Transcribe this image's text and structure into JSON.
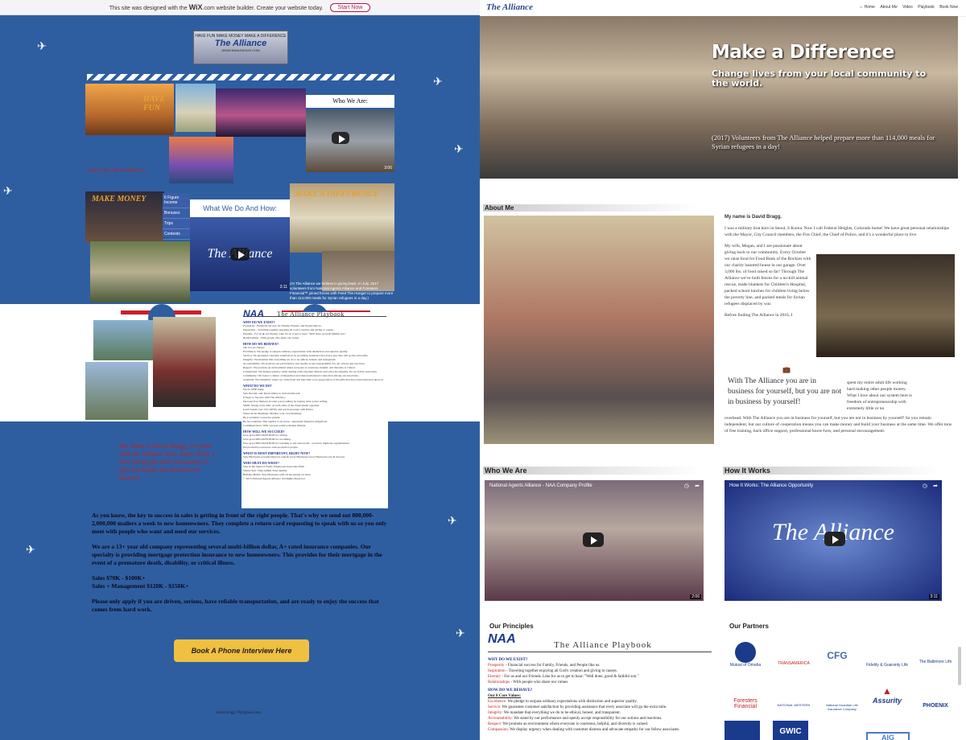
{
  "wix_banner": {
    "text": "This site was designed with the",
    "wix": "WiX",
    "text2": ".com website builder. Create your website today.",
    "button": "Start Now"
  },
  "left": {
    "logo": {
      "line1": "HAVE FUN  MAKE MONEY  MAKE A DIFFERENCE",
      "name": "The Alliance",
      "url": "WWW.NAALEAGUE.COM"
    },
    "have_fun": "HAVE FUN",
    "travel": "Travel The World With Us",
    "make_money": "MAKE MONEY",
    "make_difference": "MAKE A DIFFERENCE",
    "who_we_are": "Who We Are:",
    "what_we_do": "What We Do And How:",
    "video_logo": "The Alliance",
    "video1_duration": "3:06",
    "video2_duration": "3:11",
    "menu": [
      "6 Figure Income",
      "Bonuses",
      "Trips",
      "Contests"
    ],
    "caption": "(At The Alliance we believe in giving back. In July, 2017 volunteers from National Agents Alliance and Foresters Financial™ joined forces with Feed The Hunger to prepare more than 114,000 meals for Syrian refugees in a day.)",
    "playbook_naa": "NAA",
    "playbook_title": "The Alliance Playbook",
    "playbook_lines": [
      {
        "h": true,
        "t": "WHY DO WE EXIST?"
      },
      {
        "t": "Prosperity - Financial success for Family, Friends, and People like us."
      },
      {
        "t": "Inspiration - Traveling together enjoying all God's creation and giving to causes."
      },
      {
        "t": "Eternity - For us & our friends. Like for us to get to hear: \"Well done, good & faithful son.\""
      },
      {
        "t": "Relationships - With people who share our values"
      },
      {
        "h": true,
        "t": "HOW DO WE BEHAVE?"
      },
      {
        "t": "Our 8 Core Values:"
      },
      {
        "t": "Excellence: We pledge to surpass ordinary expectations with distinction and superior quality."
      },
      {
        "t": "Service: We guarantee customer satisfaction by providing assistance that every associate will go the extra mile."
      },
      {
        "t": "Integrity: We mandate that everything we do to be ethical, honest, and transparent."
      },
      {
        "t": "Accountability: We stand by our performance and openly accept responsibility for our actions and reactions."
      },
      {
        "t": "Respect: We promote an environment where everyone is courteous, helpful, and diversity is valued."
      },
      {
        "t": "Compassion: We display urgency when dealing with customer distress and advocate empathy for our fellow associates."
      },
      {
        "t": "Community: We foster a culture of integration and shared emotional connection among our associates."
      },
      {
        "t": "Gratitude: We remember where we come from and take time to be appreciative of the gifts that have been bestowed upon us."
      },
      {
        "h": true,
        "t": "WHAT DO WE DO?"
      },
      {
        "t": "We do ONE thing:"
      },
      {
        "t": "Sell, Recruit, and Teach Others to Sell and Recruit"
      },
      {
        "t": "6 Steps to Success with The Alliance:"
      },
      {
        "t": "Personal Use: Believe in what you're selling by buying what you're selling."
      },
      {
        "t": "Skills: Strong work ethic on both sides of the NAA/lender equation."
      },
      {
        "t": "Lead Trends: Get 15% AFTPs and reach associate with Ethics."
      },
      {
        "t": "Stand Alone Meetings: Monitor your own meetings."
      },
      {
        "t": "Be Coachable: Learn the system."
      },
      {
        "t": "Be Accountable: This applies to all areas... especially financial obligations."
      },
      {
        "t": "Communication: With a proper positive mental attitude."
      },
      {
        "h": true,
        "t": "HOW WILL WE SUCCEED?"
      },
      {
        "t": "Give great RECOGNITION for selling."
      },
      {
        "t": "Give great RECOGNITION for recruiting."
      },
      {
        "t": "Give great RECOGNITION for teaching to sell and recruit - you have duplicate organizations."
      },
      {
        "t": "Put productive resources with productive people."
      },
      {
        "h": true,
        "t": "WHAT IS MOST IMPORTANT, RIGHT NOW?"
      },
      {
        "t": "Stay Hard/pure recently          Improve rank & every Hard/pure          Grow Hard/pure rate & Success"
      },
      {
        "h": true,
        "t": "WHO MUST DO WHAT?"
      },
      {
        "t": "Stay in the Spirit of Faith | Employees          Associate          Faith"
      },
      {
        "t": "Sellers Sell | Task Admin          Trust Quality"
      },
      {
        "t": "Builders Build | Stay Hard/pure with all the energy we have."
      },
      {
        "t": "© 2015 National Agents Alliance. All Rights Reserved"
      }
    ],
    "red_text": "My Name is David Bragg. I've been with the Alliance since April, 2016. I love having the time and money to give my family the freedom we deserve!",
    "paragraphs": [
      "As you know, the key to success in sales is getting in front of the right people.  That's why we send out 800,000-2,000,000 mailers a week to new homeowners.  They complete a return card requesting to speak with us so you only meet with people who want and need our services.",
      "We are a 13+ year old company representing several multi-billion dollar, A+ rated insurance companies.  Our specialty is providing mortgage protection insurance to new homeowners.  This provides for their mortgage in the event of a premature death, disability, or critical illness.",
      "Sales $70K - $100K+\nSales + Management $120K - $150K+",
      "Please only apply if you are driven, serious, have reliable transportation, and are ready to enjoy the success that comes from hard work."
    ],
    "book_button": "Book A Phone Interview Here",
    "email": "david.bragg.79@gmail.com"
  },
  "right": {
    "brand": "The Alliance",
    "nav": [
      "Home",
      "About Me",
      "Video",
      "Playbook",
      "Book Now"
    ],
    "hero_title": "Make a Difference",
    "hero_sub": "Change lives from your local community to the world.",
    "hero_caption": "(2017) Volunteers from The Alliance helped prepare more than 114,000 meals for Syrian refugees in a day!",
    "about_heading": "About Me",
    "about_name": "My name is David Bragg.",
    "about_p1": "I was a military brat born in Seoul, S Korea. Now I call Federal Heights, Colorado home! We have great personal relationships with the Mayor, City Council members, the Fire Chief, the Chief of Police, and it's a wonderful place to live.",
    "about_p2": "My wife, Megan, and I are passionate about giving back to our community. Every October we raise food for Food Bank of the Rockies with our charity haunted house in our garage. Over 3,000 lbs. of food raised so far! Through The Alliance we've built fences for a no-kill animal rescue, made blankets for Children's Hospital, packed school lunches for children living below the poverty line, and packed meals for Syrian refugees displaced by war.",
    "about_p3a": "Before finding The Alliance in 2016, I",
    "about_p3b": "spent my entire adult life working hard making other people money. What I love about our system here is freedom of entrepreneurship with extremely little or no",
    "about_p4": "overhead. With The Alliance you are in business for yourself, but you are not in business by yourself! So you remain independent, but our culture of cooperation means you can make money and build your business at the same time. We offer tons of free training, back office support, professional know-how, and personal encouragement.",
    "quote": "With The Alliance you are in business for yourself, but you are not in business by yourself!",
    "who_heading": "Who We Are",
    "how_heading": "How It Works",
    "video_who_title": "National Agents Alliance - NAA Company Profile",
    "video_who_dur": "2:06",
    "video_how_title": "How It Works: The Alliance Opportunity",
    "video_how_dur": "3:11",
    "video_how_logo": "The Alliance",
    "principles_heading": "Our Principles",
    "partners_heading": "Our Partners",
    "pb_naa": "NAA",
    "pb_title": "The Alliance Playbook",
    "pb_lines": [
      {
        "h": true,
        "t": "WHY DO WE EXIST?"
      },
      {
        "r": "Prosperity",
        "t": " - Financial success for Family, Friends, and People like us."
      },
      {
        "r": "Inspiration",
        "t": " - Traveling together enjoying all God's creation and giving to causes."
      },
      {
        "r": "Eternity",
        "t": " - For us and our Friends. Like for us to get to hear: \"Well done, good & faithful son.\""
      },
      {
        "r": "Relationships",
        "t": " - With people who share our values"
      },
      {
        "h": true,
        "t": "HOW DO WE BEHAVE?"
      },
      {
        "t": "Our 8 Core Values:"
      },
      {
        "r": "Excellence:",
        "t": " We pledge to surpass ordinary expectations with distinction and superior quality."
      },
      {
        "r": "Service:",
        "t": " We guarantee customer satisfaction by providing assistance that every associate will go the extra mile."
      },
      {
        "r": "Integrity:",
        "t": " We mandate that everything we do to be ethical, honest, and transparent."
      },
      {
        "r": "Accountability:",
        "t": " We stand by our performance and openly accept responsibility for our actions and reactions."
      },
      {
        "r": "Respect:",
        "t": " We promote an environment where everyone is courteous, helpful, and diversity is valued."
      },
      {
        "r": "Compassion:",
        "t": " We display urgency when dealing with customer distress and advocate empathy for our fellow associates."
      }
    ],
    "partners": [
      "Mutual of Omaha",
      "TRANSAMERICA",
      "CFG",
      "Fidelity & Guaranty Life",
      "The Baltimore Life",
      "Foresters Financial",
      "NATIONAL WESTERN",
      "National Guardian Life Insurance Company",
      "Assurity",
      "PHOENIX",
      "AIG",
      "GWIC"
    ]
  }
}
